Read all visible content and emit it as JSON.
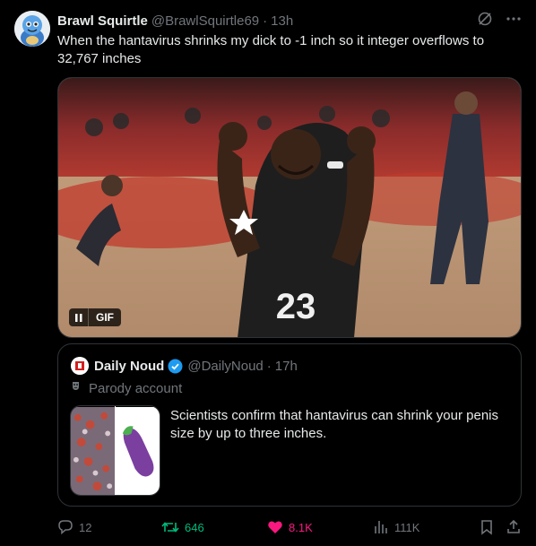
{
  "author": {
    "display_name": "Brawl Squirtle",
    "handle": "@BrawlSquirtle69",
    "time": "13h"
  },
  "tweet": {
    "text": "When the hantavirus shrinks my dick to -1 inch so it integer overflows to 32,767 inches"
  },
  "media": {
    "badge_label": "GIF",
    "jersey_number": "23"
  },
  "quote": {
    "display_name": "Daily Noud",
    "handle": "@DailyNoud",
    "time": "17h",
    "parody_label": "Parody account",
    "text": "Scientists confirm that hantavirus can shrink your penis size by up to three inches."
  },
  "actions": {
    "replies": "12",
    "retweets": "646",
    "likes": "8.1K",
    "views": "111K"
  },
  "colors": {
    "background": "#000000",
    "text": "#e7e9ea",
    "muted": "#71767b",
    "retweet": "#00ba7c",
    "like": "#f91880",
    "verified": "#1d9bf0"
  }
}
